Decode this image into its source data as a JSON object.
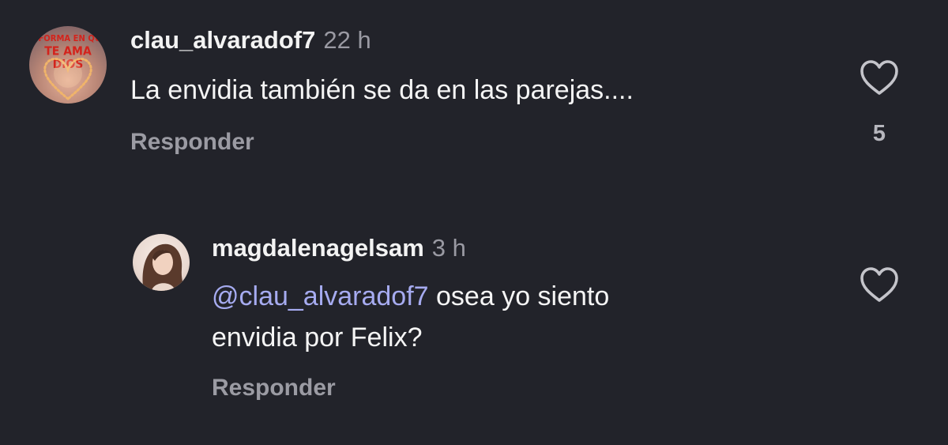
{
  "comments": [
    {
      "username": "clau_alvaradof7",
      "time": "22 h",
      "text": "La envidia también se da en las parejas....",
      "reply_label": "Responder",
      "likes": "5",
      "avatar_text": [
        "A FORMA EN QUE",
        "TE AMA DIOS"
      ]
    },
    {
      "username": "magdalenagelsam",
      "time": "3 h",
      "mention": "@clau_alvaradof7",
      "text_line1": " osea yo siento",
      "text_line2": "envidia por Felix?",
      "reply_label": "Responder"
    }
  ],
  "icons": {
    "like": "heart-outline-icon"
  },
  "colors": {
    "background": "#22232a",
    "mention": "#a6abf0",
    "secondary_text": "#9b9ba3"
  }
}
